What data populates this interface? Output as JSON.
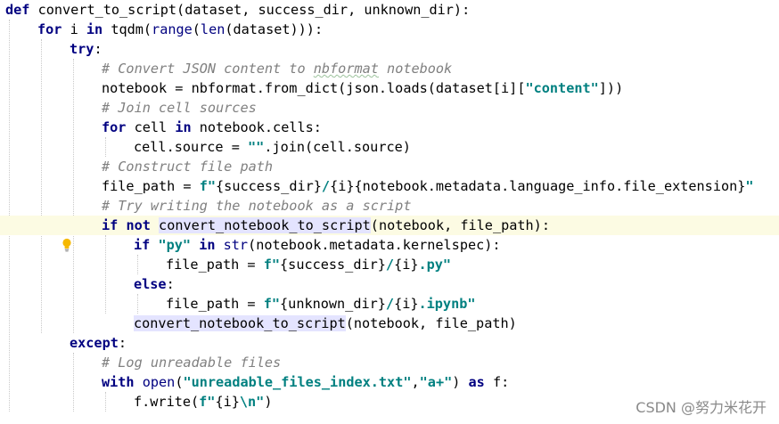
{
  "editor": {
    "lines": {
      "l1": {
        "def": "def",
        "name": "convert_to_script",
        "rest": "(dataset, success_dir, unknown_dir):"
      },
      "l2": {
        "for": "for",
        "mid": " i ",
        "in": "in",
        "tqdm": " tqdm(",
        "range": "range",
        "p1": "(",
        "len": "len",
        "rest": "(dataset))):"
      },
      "l3": {
        "try": "try",
        "colon": ":"
      },
      "l4": {
        "c1": "# Convert JSON content to ",
        "c2": "nbformat",
        "c3": " notebook"
      },
      "l5": {
        "a": "notebook = nbformat.from_dict(json.loads(dataset[i][",
        "s": "\"content\"",
        "b": "]))"
      },
      "l6": {
        "c": "# Join cell sources"
      },
      "l7": {
        "for": "for",
        "mid": " cell ",
        "in": "in",
        "rest": " notebook.cells:"
      },
      "l8": {
        "a": "cell.source = ",
        "s": "\"\"",
        "b": ".join(cell.source)"
      },
      "l9": {
        "c": "# Construct file path"
      },
      "l10": {
        "a": "file_path = ",
        "s1": "f\"",
        "b1": "{success_dir}",
        "s2": "/",
        "b2": "{i}{notebook.metadata.language_info.file_extension}",
        "s3": "\""
      },
      "l11": {
        "c": "# Try writing the notebook as a script"
      },
      "l12": {
        "if": "if",
        "sp": " ",
        "not": "not",
        "sp2": " ",
        "call": "convert_notebook_to_script",
        "rest": "(notebook, file_path):"
      },
      "l13": {
        "if": "if",
        "sp": " ",
        "s": "\"py\"",
        "sp2": " ",
        "in": "in",
        "sp3": " ",
        "str": "str",
        "rest": "(notebook.metadata.kernelspec):"
      },
      "l14": {
        "a": "file_path = ",
        "s1": "f\"",
        "b1": "{success_dir}",
        "s2": "/",
        "b2": "{i}",
        "s3": ".py\""
      },
      "l15": {
        "else": "else",
        "colon": ":"
      },
      "l16": {
        "a": "file_path = ",
        "s1": "f\"",
        "b1": "{unknown_dir}",
        "s2": "/",
        "b2": "{i}",
        "s3": ".ipynb\""
      },
      "l17": {
        "call": "convert_notebook_to_script",
        "rest": "(notebook, file_path)"
      },
      "l18": {
        "except": "except",
        "colon": ":"
      },
      "l19": {
        "c": "# Log unreadable files"
      },
      "l20": {
        "with": "with",
        "sp": " ",
        "open": "open",
        "p": "(",
        "s1": "\"unreadable_files_index.txt\"",
        "comma": ",",
        "s2": "\"a+\"",
        "p2": ") ",
        "as": "as",
        "rest": " f:"
      },
      "l21": {
        "a": "f.write(",
        "s1": "f\"",
        "b": "{i}",
        "s2": "\\n\"",
        "c": ")"
      }
    }
  },
  "gutter": {
    "intention_icon": "lightbulb-icon",
    "intention_color": "#f5b800"
  },
  "watermark": {
    "text": "CSDN @努力米花开"
  },
  "colors": {
    "keyword": "#000080",
    "string": "#008080",
    "comment": "#808080",
    "current_line": "#fcfbe3",
    "usage_highlight": "#e4e4ff"
  }
}
